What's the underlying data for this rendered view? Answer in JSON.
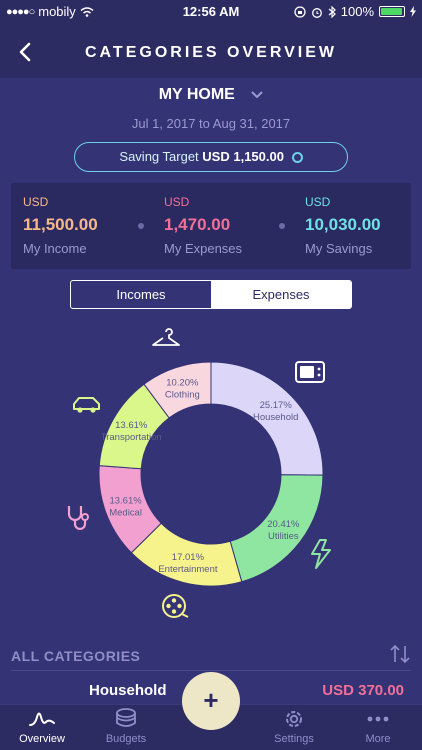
{
  "status": {
    "carrier": "mobily",
    "time": "12:56 AM",
    "battery": "100%"
  },
  "header": {
    "title": "CATEGORIES OVERVIEW"
  },
  "account": {
    "name": "MY HOME",
    "date_range": "Jul 1, 2017 to Aug 31, 2017"
  },
  "saving_target": {
    "label": "Saving Target",
    "amount": "USD 1,150.00"
  },
  "summary": {
    "income": {
      "currency": "USD",
      "value": "11,500.00",
      "label": "My Income",
      "color": "#f6b98a"
    },
    "expenses": {
      "currency": "USD",
      "value": "1,470.00",
      "label": "My Expenses",
      "color": "#f0709a"
    },
    "savings": {
      "currency": "USD",
      "value": "10,030.00",
      "label": "My Savings",
      "color": "#6fe0e6"
    }
  },
  "segments": {
    "incomes": "Incomes",
    "expenses": "Expenses",
    "selected": "expenses"
  },
  "chart_data": {
    "type": "pie",
    "donut": true,
    "categories": [
      "Household",
      "Utilities",
      "Entertainment",
      "Medical",
      "Transportation",
      "Clothing"
    ],
    "values": [
      25.17,
      20.41,
      17.01,
      13.61,
      13.61,
      10.2
    ],
    "labels": [
      "25.17%",
      "20.41%",
      "17.01%",
      "13.61%",
      "13.61%",
      "10.20%"
    ],
    "colors": [
      "#dcd7f8",
      "#8ee6a0",
      "#f6f28c",
      "#f2a0d0",
      "#d9f78a",
      "#f9d7df"
    ],
    "icons": [
      "tv-icon",
      "lightning-icon",
      "film-reel-icon",
      "stethoscope-icon",
      "car-icon",
      "hanger-icon"
    ],
    "icon_colors": [
      "#ffffff",
      "#8ee6a0",
      "#f6f28c",
      "#f2a0d0",
      "#d9f78a",
      "#ffffff"
    ]
  },
  "list": {
    "header": "ALL CATEGORIES",
    "rows": [
      {
        "label": "Household",
        "amount": "USD 370.00"
      }
    ]
  },
  "tabbar": {
    "overview": "Overview",
    "budgets": "Budgets",
    "add": "+",
    "settings": "Settings",
    "more": "More"
  }
}
